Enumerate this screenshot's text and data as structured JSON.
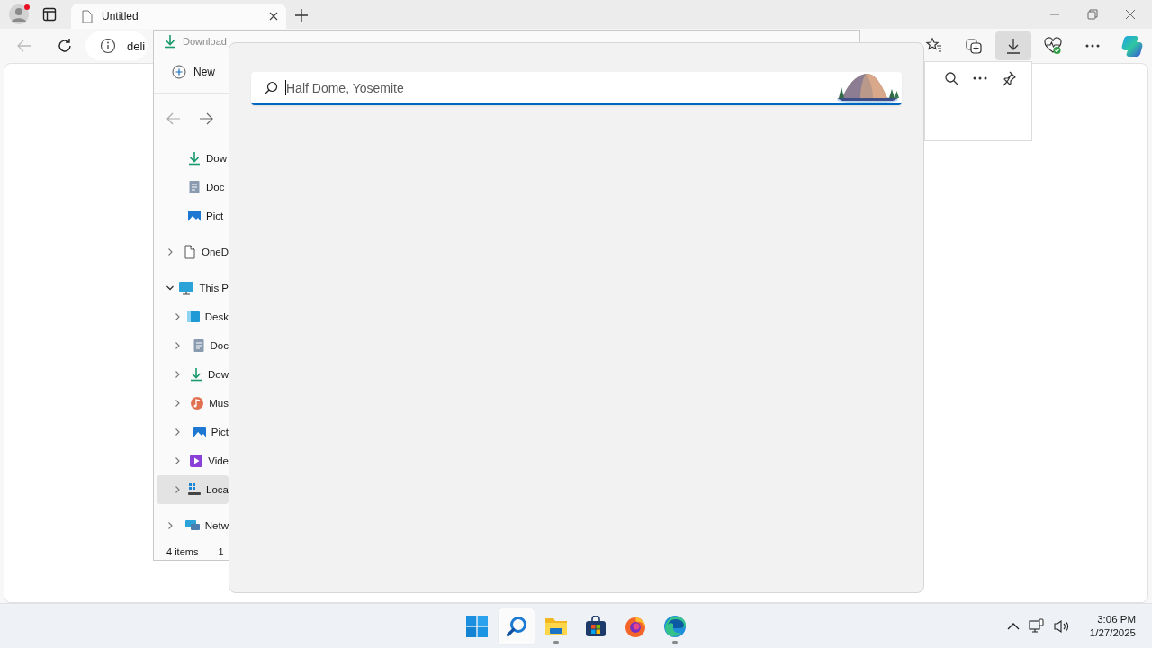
{
  "browser": {
    "tabs": [
      {
        "title": "Untitled",
        "selected": true
      }
    ],
    "address": "deli",
    "toolbar": [
      {
        "kind": "favorites",
        "selected": false
      },
      {
        "kind": "collections",
        "selected": false
      },
      {
        "kind": "downloads",
        "selected": true
      },
      {
        "kind": "health",
        "selected": false
      },
      {
        "kind": "more",
        "selected": false
      },
      {
        "kind": "copilot",
        "selected": false
      }
    ]
  },
  "downloads_panel": {
    "tools": [
      {
        "kind": "search"
      },
      {
        "kind": "more"
      },
      {
        "kind": "pin"
      }
    ]
  },
  "explorer": {
    "title": "Download",
    "new_button": "New",
    "pinned": [
      {
        "label": "Dow",
        "kind": "downloads",
        "selected": false
      },
      {
        "label": "Doc",
        "kind": "documents",
        "selected": false
      },
      {
        "label": "Pict",
        "kind": "pictures",
        "selected": false
      }
    ],
    "tree": [
      {
        "label": "OneD",
        "kind": "file",
        "expanded": false,
        "selected": false
      },
      {
        "label": "This P",
        "kind": "pc",
        "expanded": true,
        "selected": false,
        "children": [
          {
            "label": "Desk",
            "kind": "desktop",
            "expanded": false,
            "selected": false
          },
          {
            "label": "Doc",
            "kind": "documents",
            "expanded": false,
            "selected": false
          },
          {
            "label": "Dow",
            "kind": "downloads",
            "expanded": false,
            "selected": false
          },
          {
            "label": "Mus",
            "kind": "music",
            "expanded": false,
            "selected": false
          },
          {
            "label": "Pict",
            "kind": "pictures",
            "expanded": false,
            "selected": false
          },
          {
            "label": "Vide",
            "kind": "videos",
            "expanded": false,
            "selected": false
          },
          {
            "label": "Loca",
            "kind": "drive",
            "expanded": false,
            "selected": true
          }
        ]
      },
      {
        "label": "Netw",
        "kind": "network",
        "expanded": false,
        "selected": false
      }
    ],
    "status": [
      "4 items",
      "1"
    ]
  },
  "search": {
    "placeholder": "Half Dome, Yosemite"
  },
  "taskbar": {
    "apps": [
      {
        "kind": "start",
        "selected": false,
        "running": false
      },
      {
        "kind": "search",
        "selected": true,
        "running": false
      },
      {
        "kind": "explorer",
        "selected": false,
        "running": true
      },
      {
        "kind": "store",
        "selected": false,
        "running": false
      },
      {
        "kind": "firefox",
        "selected": false,
        "running": false
      },
      {
        "kind": "edge",
        "selected": false,
        "running": true
      }
    ],
    "time": "3:06 PM",
    "date": "1/27/2025"
  }
}
